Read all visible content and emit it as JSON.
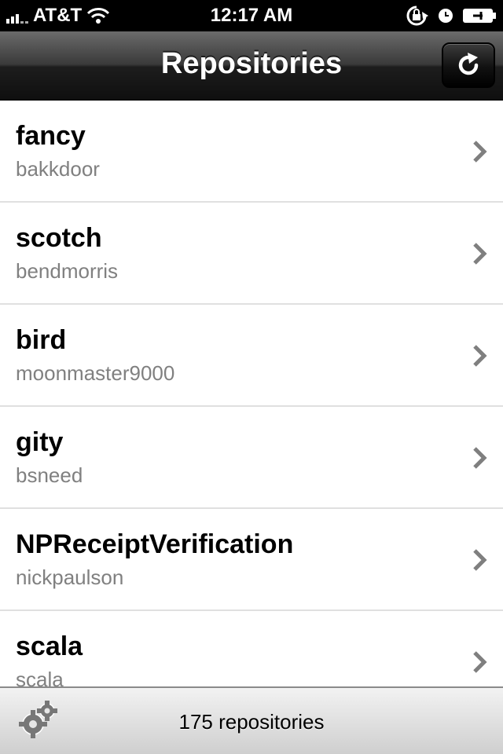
{
  "status_bar": {
    "carrier": "AT&T",
    "time": "12:17 AM",
    "icons": [
      "signal-icon",
      "wifi-icon",
      "rotation-lock-icon",
      "alarm-icon",
      "battery-icon"
    ]
  },
  "nav": {
    "title": "Repositories",
    "refresh_icon": "refresh-icon"
  },
  "repositories": [
    {
      "name": "fancy",
      "owner": "bakkdoor"
    },
    {
      "name": "scotch",
      "owner": "bendmorris"
    },
    {
      "name": "bird",
      "owner": "moonmaster9000"
    },
    {
      "name": "gity",
      "owner": "bsneed"
    },
    {
      "name": "NPReceiptVerification",
      "owner": "nickpaulson"
    },
    {
      "name": "scala",
      "owner": "scala"
    }
  ],
  "toolbar": {
    "settings_icon": "gears-icon",
    "count_label": "175 repositories"
  },
  "colors": {
    "nav_dark": "#1d1d1d",
    "owner_gray": "#808080",
    "chevron_gray": "#7f7f7f",
    "separator": "#e0e0e0"
  }
}
